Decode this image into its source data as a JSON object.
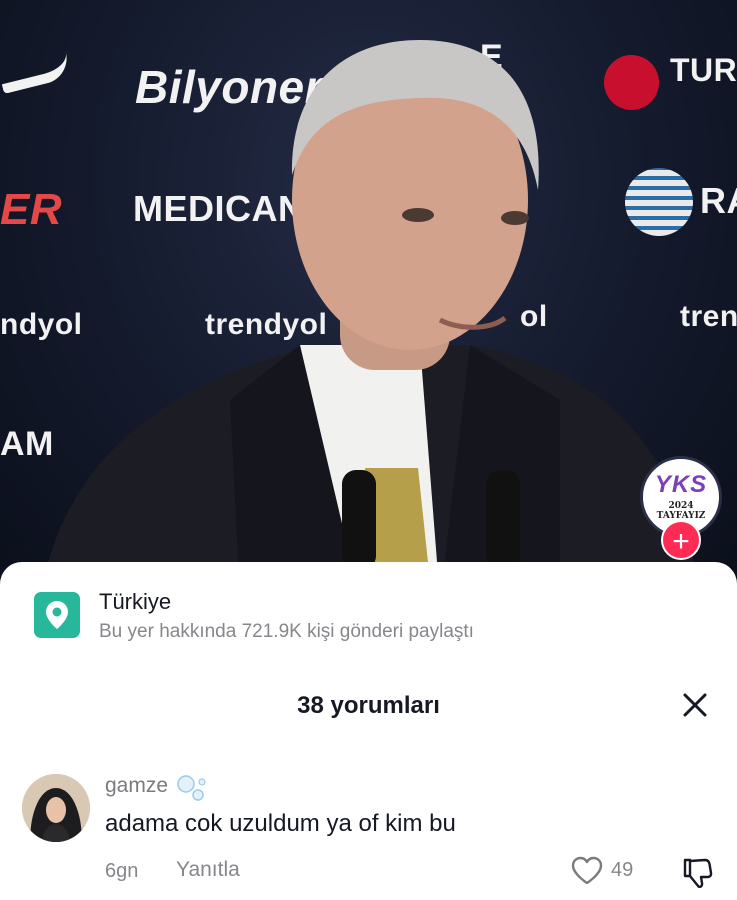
{
  "video": {
    "sponsors": [
      "Bilyoner",
      "MEDICANA",
      "ER",
      "ndyol",
      "AM",
      "trendyol",
      "TURK AIRL",
      "RA",
      "trend",
      "ol",
      "E"
    ],
    "badge": {
      "title": "YKS",
      "subtitle": "2024 TAYFAYIZ"
    },
    "follow_icon": "plus-icon"
  },
  "location": {
    "icon": "map-pin-icon",
    "name": "Türkiye",
    "subtitle": "Bu yer hakkında 721.9K kişi gönderi paylaştı"
  },
  "comments_header": {
    "title": "38 yorumları",
    "close_icon": "close-icon"
  },
  "comments": [
    {
      "username": "gamze",
      "username_emoji_icon": "bubbles-icon",
      "text": "adama cok uzuldum ya of kim bu",
      "time": "6gn",
      "reply_label": "Yanıtla",
      "likes": "49"
    }
  ],
  "colors": {
    "accent": "#fe2c55",
    "location_icon_bg": "#27b79b",
    "muted_text": "#86878b",
    "primary_text": "#161823"
  }
}
